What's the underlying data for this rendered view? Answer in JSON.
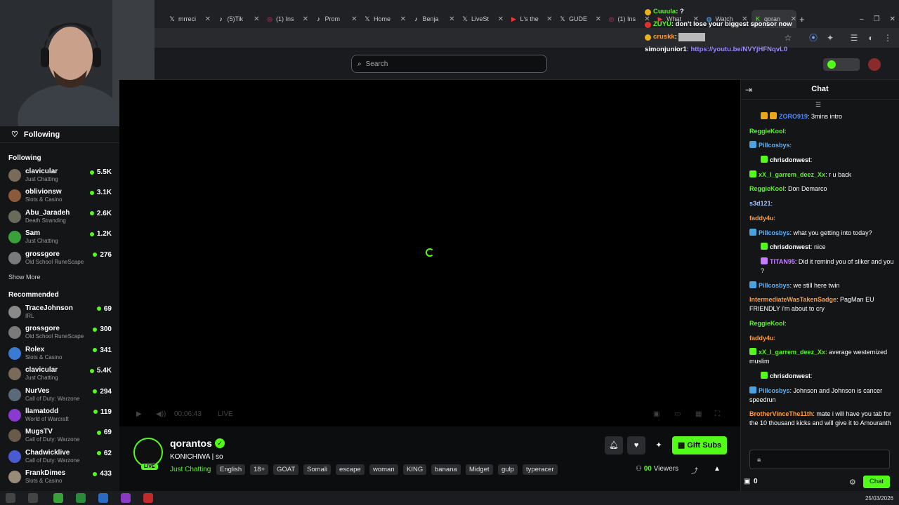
{
  "browser": {
    "tabs": [
      {
        "icon": "x-icon",
        "label": "mrreci"
      },
      {
        "icon": "tiktok-icon",
        "label": "(5)Tik"
      },
      {
        "icon": "instagram-icon",
        "label": "(1) Ins"
      },
      {
        "icon": "tiktok-icon",
        "label": "Prom"
      },
      {
        "icon": "x-icon",
        "label": "Home"
      },
      {
        "icon": "tiktok-icon",
        "label": "Benja"
      },
      {
        "icon": "x-icon",
        "label": "LiveSt"
      },
      {
        "icon": "youtube-icon",
        "label": "L's the"
      },
      {
        "icon": "x-icon",
        "label": "GUDE"
      },
      {
        "icon": "instagram-icon",
        "label": "(1) Ins"
      },
      {
        "icon": "youtube-icon",
        "label": "What"
      },
      {
        "icon": "globe-icon",
        "label": "Watch"
      },
      {
        "icon": "kick-icon",
        "label": "qoran"
      }
    ],
    "new_tab": "+"
  },
  "overlay_chat": [
    {
      "user": "Cuuula",
      "text": " : ?",
      "color": "#53fc18",
      "badge": "#e8b21a"
    },
    {
      "user": "ZUYU",
      "text": " : don't lose your biggest sponsor now",
      "color": "#53fc18",
      "badge": "#e03030"
    },
    {
      "user": "cruskk",
      "text": " : ",
      "color": "#ff9d3b",
      "badge": "#e8b21a"
    },
    {
      "user": "simonjunior1",
      "text": " : https://youtu.be/NVYjHFNqvL0",
      "color": "#ffffff",
      "badge": ""
    }
  ],
  "header": {
    "search_placeholder": "Search"
  },
  "sidebar": {
    "following_header": "Following",
    "following_section": "Following",
    "following": [
      {
        "name": "clavicular",
        "category": "Just Chatting",
        "viewers": "5.5K",
        "color": "#7a6a5a"
      },
      {
        "name": "oblivionsw",
        "category": "Slots & Casino",
        "viewers": "3.1K",
        "color": "#8a5a3a"
      },
      {
        "name": "Abu_Jaradeh",
        "category": "Death Stranding",
        "viewers": "2.6K",
        "color": "#6a6a5a"
      },
      {
        "name": "Sam",
        "category": "Just Chatting",
        "viewers": "1.2K",
        "color": "#3aa03a"
      },
      {
        "name": "grossgore",
        "category": "Old School RuneScape",
        "viewers": "276",
        "color": "#7a7a7a"
      }
    ],
    "show_more": "Show More",
    "recommended_section": "Recommended",
    "recommended": [
      {
        "name": "TraceJohnson",
        "category": "IRL",
        "viewers": "69",
        "color": "#8a8a8a"
      },
      {
        "name": "grossgore",
        "category": "Old School RuneScape",
        "viewers": "300",
        "color": "#7a7a7a"
      },
      {
        "name": "Rolex",
        "category": "Slots & Casino",
        "viewers": "341",
        "color": "#3a7ad0"
      },
      {
        "name": "clavicular",
        "category": "Just Chatting",
        "viewers": "5.4K",
        "color": "#7a6a5a"
      },
      {
        "name": "NurVes",
        "category": "Call of Duty: Warzone",
        "viewers": "294",
        "color": "#5a6a7a"
      },
      {
        "name": "llamatodd",
        "category": "World of Warcraft",
        "viewers": "119",
        "color": "#8a3ad0"
      },
      {
        "name": "MugsTV",
        "category": "Call of Duty: Warzone",
        "viewers": "69",
        "color": "#6a5a4a"
      },
      {
        "name": "Chadwicklive",
        "category": "Call of Duty: Warzone",
        "viewers": "62",
        "color": "#4a5ad0"
      },
      {
        "name": "FrankDimes",
        "category": "Slots & Casino",
        "viewers": "433",
        "color": "#9a8a7a"
      }
    ]
  },
  "player": {
    "time": "00:06:43",
    "live": "LIVE"
  },
  "stream": {
    "streamer": "qorantos",
    "live_badge": "LIVE",
    "title": "KONICHIWA | so",
    "category": "Just Chatting",
    "tags": [
      "English",
      "18+",
      "GOAT",
      "Somali",
      "escape",
      "woman",
      "KING",
      "banana",
      "Midget",
      "gulp",
      "typeracer"
    ],
    "gift_subs": "Gift Subs",
    "viewers_count": "00",
    "viewers_label": " Viewers"
  },
  "chat": {
    "title": "Chat",
    "messages": [
      {
        "user": "ZORO919",
        "text": ": 3mins intro",
        "color": "#4e8cff",
        "badges": [
          "#e8a81a",
          "#e8a81a"
        ]
      },
      {
        "user": "ReggieKool",
        "text": ":",
        "color": "#53fc18",
        "badges": []
      },
      {
        "user": "Pillcosbys",
        "text": ":",
        "color": "#5ab4ff",
        "badges": [
          "#4aa3e0"
        ]
      },
      {
        "user": "chrisdonwest",
        "text": ":",
        "color": "#ffffff",
        "badges": [
          "#53fc18"
        ]
      },
      {
        "user": "xX_I_garrem_deez_Xx",
        "text": ": r u back",
        "color": "#53fc18",
        "badges": [
          "#53fc18"
        ]
      },
      {
        "user": "ReggieKool",
        "text": ": Don Demarco",
        "color": "#53fc18",
        "badges": []
      },
      {
        "user": "s3d121",
        "text": ":",
        "color": "#a0c4ff",
        "badges": []
      },
      {
        "user": "faddy4u",
        "text": ":",
        "color": "#ff9d3b",
        "badges": []
      },
      {
        "user": "Pillcosbys",
        "text": ": what you getting into today?",
        "color": "#5ab4ff",
        "badges": [
          "#4aa3e0"
        ]
      },
      {
        "user": "chrisdonwest",
        "text": ": nice",
        "color": "#ffffff",
        "badges": [
          "#53fc18"
        ]
      },
      {
        "user": "TITAN95",
        "text": ": Did it remind you of sliker and you ?",
        "color": "#c77dff",
        "badges": [
          "#c77dff"
        ]
      },
      {
        "user": "Pillcosbys",
        "text": ": we still here twin",
        "color": "#5ab4ff",
        "badges": [
          "#4aa3e0"
        ]
      },
      {
        "user": "IntermediateWasTakenSadge",
        "text": ": PagMan EU FRIENDLY i'm about to cry",
        "color": "#ff9d3b",
        "badges": []
      },
      {
        "user": "ReggieKool",
        "text": ":",
        "color": "#53fc18",
        "badges": []
      },
      {
        "user": "faddy4u",
        "text": ":",
        "color": "#ff9d3b",
        "badges": []
      },
      {
        "user": "xX_I_garrem_deez_Xx",
        "text": ": average westernized muslim",
        "color": "#53fc18",
        "badges": [
          "#53fc18"
        ]
      },
      {
        "user": "chrisdonwest",
        "text": ":",
        "color": "#ffffff",
        "badges": [
          "#53fc18"
        ]
      },
      {
        "user": "Pillcosbys",
        "text": ": Johnson and Johnson is cancer speedrun",
        "color": "#5ab4ff",
        "badges": [
          "#4aa3e0"
        ]
      },
      {
        "user": "BrotherVinceThe11th",
        "text": ": mate i will have you tab for the 10 thousand kicks and will give it to Amouranth",
        "color": "#ff9d3b",
        "badges": []
      }
    ],
    "points": "0",
    "send_label": "Chat"
  },
  "taskbar": {
    "date": "25/03/2026"
  }
}
